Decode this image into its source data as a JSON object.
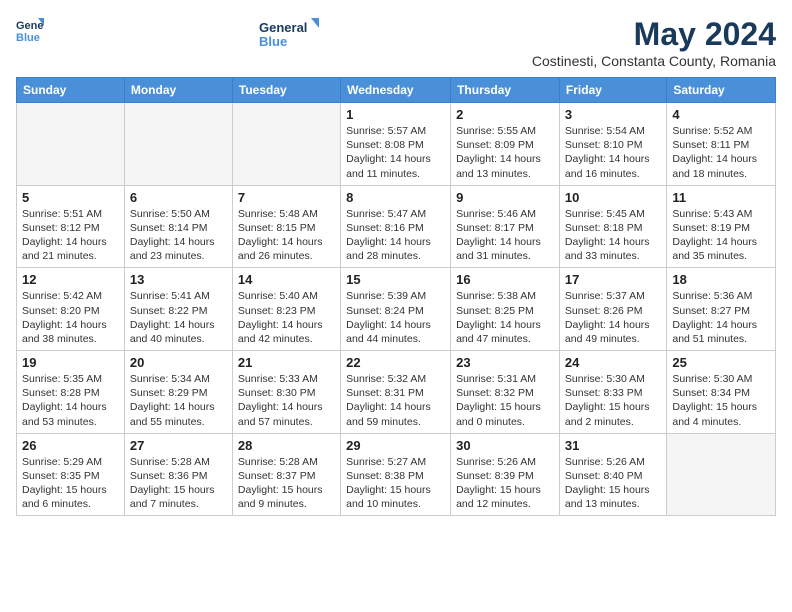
{
  "header": {
    "logo_line1": "General",
    "logo_line2": "Blue",
    "month_title": "May 2024",
    "subtitle": "Costinesti, Constanta County, Romania"
  },
  "weekdays": [
    "Sunday",
    "Monday",
    "Tuesday",
    "Wednesday",
    "Thursday",
    "Friday",
    "Saturday"
  ],
  "weeks": [
    [
      {
        "day": "",
        "info": ""
      },
      {
        "day": "",
        "info": ""
      },
      {
        "day": "",
        "info": ""
      },
      {
        "day": "1",
        "info": "Sunrise: 5:57 AM\nSunset: 8:08 PM\nDaylight: 14 hours\nand 11 minutes."
      },
      {
        "day": "2",
        "info": "Sunrise: 5:55 AM\nSunset: 8:09 PM\nDaylight: 14 hours\nand 13 minutes."
      },
      {
        "day": "3",
        "info": "Sunrise: 5:54 AM\nSunset: 8:10 PM\nDaylight: 14 hours\nand 16 minutes."
      },
      {
        "day": "4",
        "info": "Sunrise: 5:52 AM\nSunset: 8:11 PM\nDaylight: 14 hours\nand 18 minutes."
      }
    ],
    [
      {
        "day": "5",
        "info": "Sunrise: 5:51 AM\nSunset: 8:12 PM\nDaylight: 14 hours\nand 21 minutes."
      },
      {
        "day": "6",
        "info": "Sunrise: 5:50 AM\nSunset: 8:14 PM\nDaylight: 14 hours\nand 23 minutes."
      },
      {
        "day": "7",
        "info": "Sunrise: 5:48 AM\nSunset: 8:15 PM\nDaylight: 14 hours\nand 26 minutes."
      },
      {
        "day": "8",
        "info": "Sunrise: 5:47 AM\nSunset: 8:16 PM\nDaylight: 14 hours\nand 28 minutes."
      },
      {
        "day": "9",
        "info": "Sunrise: 5:46 AM\nSunset: 8:17 PM\nDaylight: 14 hours\nand 31 minutes."
      },
      {
        "day": "10",
        "info": "Sunrise: 5:45 AM\nSunset: 8:18 PM\nDaylight: 14 hours\nand 33 minutes."
      },
      {
        "day": "11",
        "info": "Sunrise: 5:43 AM\nSunset: 8:19 PM\nDaylight: 14 hours\nand 35 minutes."
      }
    ],
    [
      {
        "day": "12",
        "info": "Sunrise: 5:42 AM\nSunset: 8:20 PM\nDaylight: 14 hours\nand 38 minutes."
      },
      {
        "day": "13",
        "info": "Sunrise: 5:41 AM\nSunset: 8:22 PM\nDaylight: 14 hours\nand 40 minutes."
      },
      {
        "day": "14",
        "info": "Sunrise: 5:40 AM\nSunset: 8:23 PM\nDaylight: 14 hours\nand 42 minutes."
      },
      {
        "day": "15",
        "info": "Sunrise: 5:39 AM\nSunset: 8:24 PM\nDaylight: 14 hours\nand 44 minutes."
      },
      {
        "day": "16",
        "info": "Sunrise: 5:38 AM\nSunset: 8:25 PM\nDaylight: 14 hours\nand 47 minutes."
      },
      {
        "day": "17",
        "info": "Sunrise: 5:37 AM\nSunset: 8:26 PM\nDaylight: 14 hours\nand 49 minutes."
      },
      {
        "day": "18",
        "info": "Sunrise: 5:36 AM\nSunset: 8:27 PM\nDaylight: 14 hours\nand 51 minutes."
      }
    ],
    [
      {
        "day": "19",
        "info": "Sunrise: 5:35 AM\nSunset: 8:28 PM\nDaylight: 14 hours\nand 53 minutes."
      },
      {
        "day": "20",
        "info": "Sunrise: 5:34 AM\nSunset: 8:29 PM\nDaylight: 14 hours\nand 55 minutes."
      },
      {
        "day": "21",
        "info": "Sunrise: 5:33 AM\nSunset: 8:30 PM\nDaylight: 14 hours\nand 57 minutes."
      },
      {
        "day": "22",
        "info": "Sunrise: 5:32 AM\nSunset: 8:31 PM\nDaylight: 14 hours\nand 59 minutes."
      },
      {
        "day": "23",
        "info": "Sunrise: 5:31 AM\nSunset: 8:32 PM\nDaylight: 15 hours\nand 0 minutes."
      },
      {
        "day": "24",
        "info": "Sunrise: 5:30 AM\nSunset: 8:33 PM\nDaylight: 15 hours\nand 2 minutes."
      },
      {
        "day": "25",
        "info": "Sunrise: 5:30 AM\nSunset: 8:34 PM\nDaylight: 15 hours\nand 4 minutes."
      }
    ],
    [
      {
        "day": "26",
        "info": "Sunrise: 5:29 AM\nSunset: 8:35 PM\nDaylight: 15 hours\nand 6 minutes."
      },
      {
        "day": "27",
        "info": "Sunrise: 5:28 AM\nSunset: 8:36 PM\nDaylight: 15 hours\nand 7 minutes."
      },
      {
        "day": "28",
        "info": "Sunrise: 5:28 AM\nSunset: 8:37 PM\nDaylight: 15 hours\nand 9 minutes."
      },
      {
        "day": "29",
        "info": "Sunrise: 5:27 AM\nSunset: 8:38 PM\nDaylight: 15 hours\nand 10 minutes."
      },
      {
        "day": "30",
        "info": "Sunrise: 5:26 AM\nSunset: 8:39 PM\nDaylight: 15 hours\nand 12 minutes."
      },
      {
        "day": "31",
        "info": "Sunrise: 5:26 AM\nSunset: 8:40 PM\nDaylight: 15 hours\nand 13 minutes."
      },
      {
        "day": "",
        "info": ""
      }
    ]
  ]
}
